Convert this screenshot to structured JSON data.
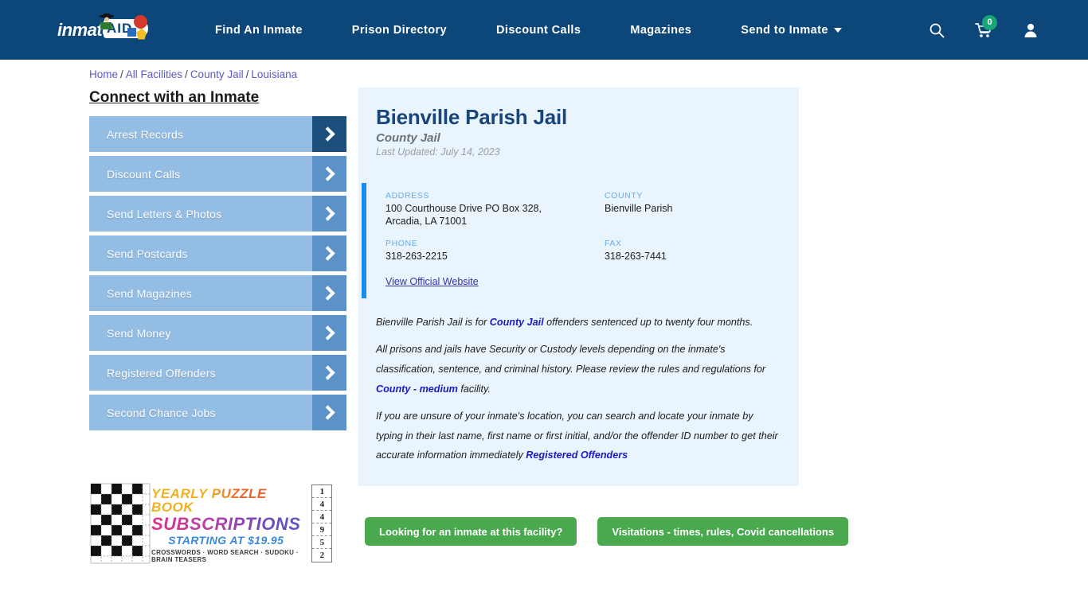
{
  "header": {
    "logo": {
      "text": "inmate",
      "badge": "AID",
      "name": "inmateaid-logo"
    },
    "nav": [
      {
        "label": "Find An Inmate",
        "caret": false
      },
      {
        "label": "Prison Directory",
        "caret": false
      },
      {
        "label": "Discount Calls",
        "caret": false
      },
      {
        "label": "Magazines",
        "caret": false
      },
      {
        "label": "Send to Inmate",
        "caret": true
      }
    ],
    "icons": {
      "search": "search-icon",
      "cart": "shopping-cart-icon",
      "cart_count": "0",
      "account": "user-account-icon"
    },
    "bg_color": "#0d4678",
    "badge_color": "#18a678"
  },
  "breadcrumb": {
    "items": [
      "Home",
      "All Facilities",
      "County Jail",
      "Louisiana"
    ],
    "separator": "/"
  },
  "sidebar": {
    "title": "Connect with an Inmate",
    "items": [
      {
        "label": "Arrest Records",
        "active": true
      },
      {
        "label": "Discount Calls",
        "active": false
      },
      {
        "label": "Send Letters & Photos",
        "active": false
      },
      {
        "label": "Send Postcards",
        "active": false
      },
      {
        "label": "Send Magazines",
        "active": false
      },
      {
        "label": "Send Money",
        "active": false
      },
      {
        "label": "Registered Offenders",
        "active": false
      },
      {
        "label": "Second Chance Jobs",
        "active": false
      }
    ]
  },
  "ad": {
    "line1": "YEARLY PUZZLE BOOK",
    "line2": "SUBSCRIPTIONS",
    "line3": "STARTING AT $19.95",
    "line4": "CROSSWORDS · WORD SEARCH · SUDOKU · BRAIN TEASERS",
    "sudoku_digits": [
      "1",
      "4",
      "4",
      "9",
      "5",
      "2"
    ]
  },
  "facility": {
    "name": "Bienville Parish Jail",
    "type": "County Jail",
    "last_updated": "Last Updated: July 14, 2023",
    "contact": {
      "address_label": "ADDRESS",
      "address_line1": "100 Courthouse Drive PO Box 328,",
      "address_line2": "Arcadia, LA 71001",
      "county_label": "COUNTY",
      "county_value": "Bienville Parish",
      "phone_label": "PHONE",
      "phone_value": "318-263-2215",
      "fax_label": "FAX",
      "fax_value": "318-263-7441",
      "website_link": "View Official Website"
    },
    "paragraphs": {
      "p1_a": "Bienville Parish Jail is for ",
      "p1_link": "County Jail",
      "p1_b": " offenders sentenced up to twenty four months.",
      "p2_a": "All prisons and jails have Security or Custody levels depending on the inmate's classification, sentence, and criminal history. Please review the rules and regulations for ",
      "p2_link": "County - medium",
      "p2_b": " facility.",
      "p3_a": "If you are unsure of your inmate's location, you can search and locate your inmate by typing in their last name, first name or first initial, and/or the offender ID number to get their accurate information immediately ",
      "p3_link": "Registered Offenders"
    }
  },
  "cta": {
    "buttons": [
      "Looking for an inmate at this facility?",
      "Visitations - times, rules, Covid cancellations"
    ],
    "color": "#4aa94f"
  }
}
